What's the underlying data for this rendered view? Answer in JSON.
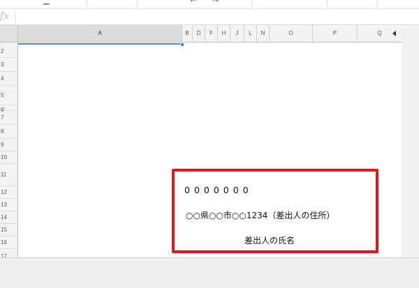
{
  "toolbar": {
    "arrow_left_glyph": "⇠",
    "arrow_right_glyph": "⇢",
    "left_glyph": "▁"
  },
  "formula_bar": {
    "fx_label": "fx",
    "value": ""
  },
  "columns": [
    {
      "label": "A",
      "selected": true
    },
    {
      "label": "B"
    },
    {
      "label": "D"
    },
    {
      "label": "F"
    },
    {
      "label": "H"
    },
    {
      "label": "J"
    },
    {
      "label": "L"
    },
    {
      "label": "N"
    },
    {
      "label": "O"
    },
    {
      "label": "P"
    },
    {
      "label": "Q"
    }
  ],
  "rows": [
    "2",
    "3",
    "4",
    "5",
    "6",
    "7",
    "8",
    "9",
    "10",
    "11",
    "12",
    "13",
    "14",
    "15",
    "16",
    "17"
  ],
  "icons": {
    "scroll_arrow": "triangle-left-icon",
    "fx": "function-icon"
  },
  "colors": {
    "highlight_border": "#e8141b",
    "selection": "#4a86e8"
  },
  "envelope": {
    "postal_code": "0000000",
    "address": "○○県○○市○○1234（差出人の住所）",
    "sender_name": "差出人の氏名"
  }
}
